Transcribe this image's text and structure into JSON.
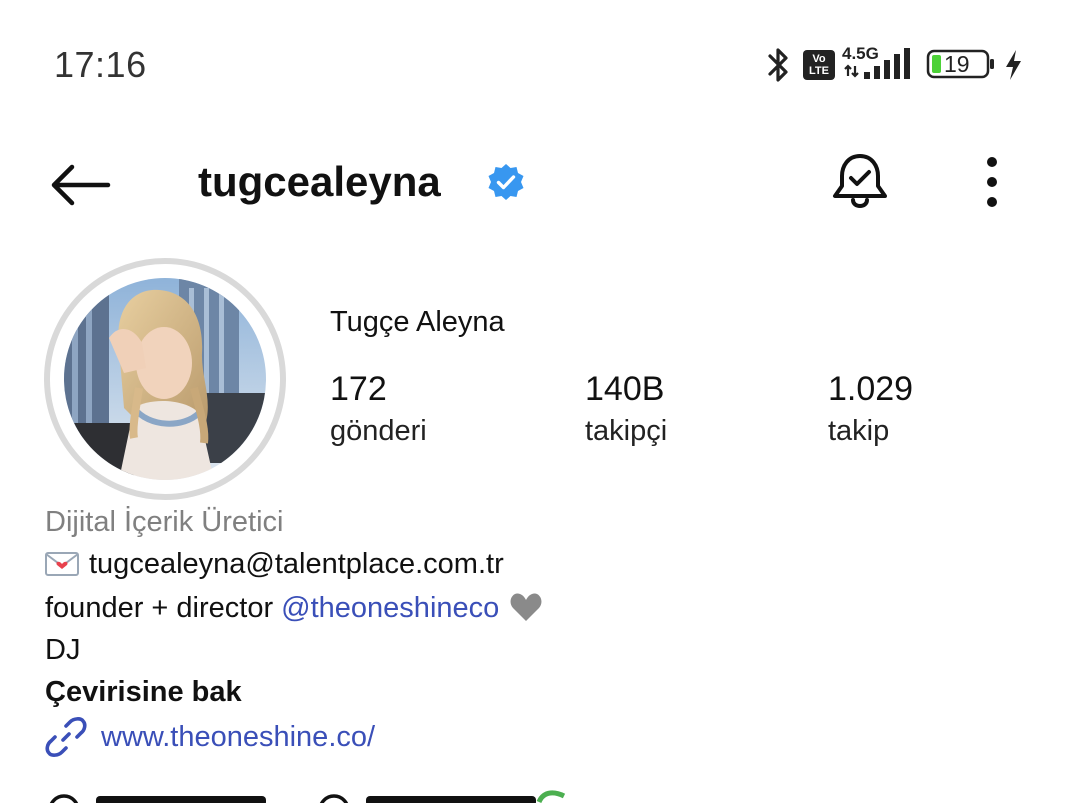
{
  "status_bar": {
    "time": "17:16",
    "network": "4.5G",
    "volte": "Vo LTE",
    "battery": "19",
    "icons": [
      "bluetooth-icon",
      "volte-icon",
      "signal-icon",
      "battery-icon",
      "charging-icon"
    ]
  },
  "header": {
    "username": "tugcealeyna",
    "verified": true,
    "icons": [
      "back-arrow-icon",
      "verified-badge-icon",
      "bell-check-icon",
      "more-vertical-icon"
    ]
  },
  "profile": {
    "display_name": "Tugçe Aleyna",
    "stats": [
      {
        "value": "172",
        "label": "gönderi"
      },
      {
        "value": "140B",
        "label": "takipçi"
      },
      {
        "value": "1.029",
        "label": "takip"
      }
    ]
  },
  "bio": {
    "category": "Dijital İçerik Üretici",
    "email": "tugcealeyna@talentplace.com.tr",
    "founder_prefix": "founder + director",
    "founder_mention": "@theoneshineco",
    "line3": "DJ",
    "translate": "Çevirisine bak",
    "website": "www.theoneshine.co/"
  },
  "colors": {
    "link": "#3a4fb8",
    "category": "#808080",
    "verified": "#3897f0",
    "battery_fill": "#4cd137"
  }
}
